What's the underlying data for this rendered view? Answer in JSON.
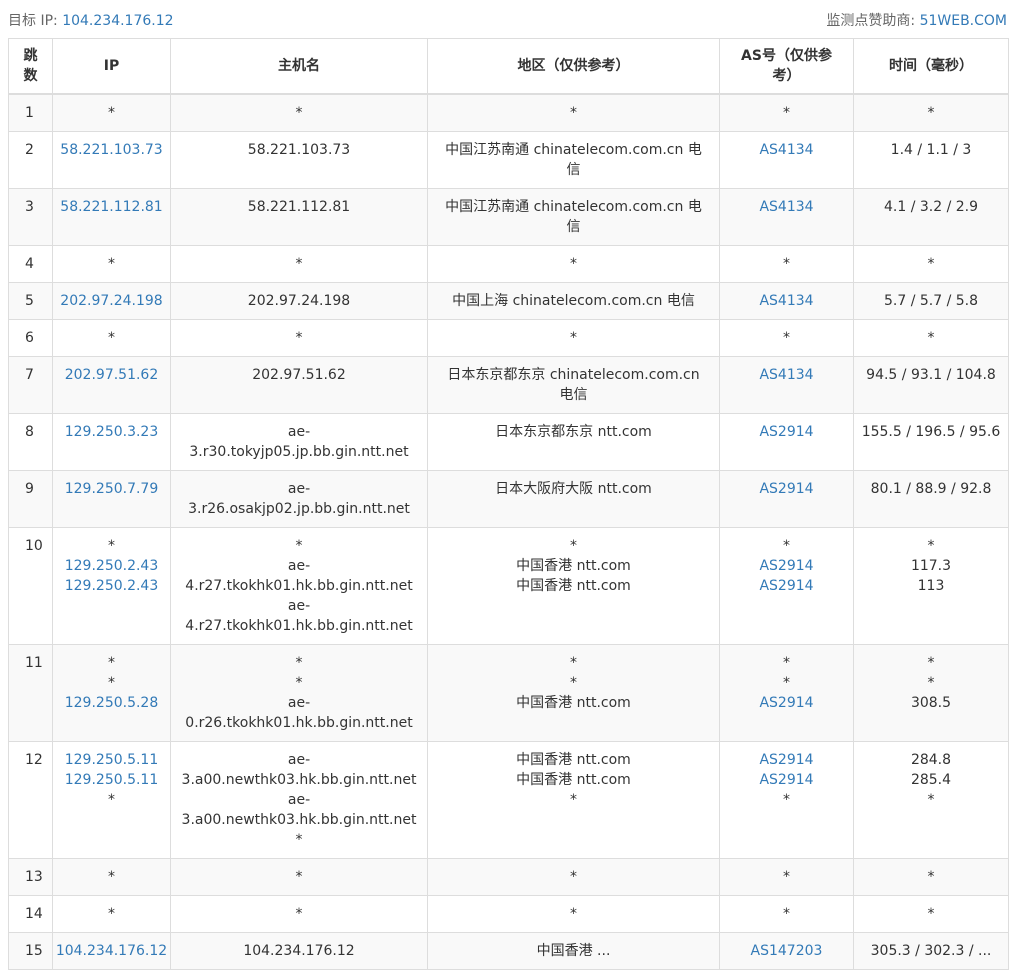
{
  "header": {
    "target_label": "目标 IP:",
    "target_ip": "104.234.176.12",
    "sponsor_label": "监测点赞助商:",
    "sponsor_name": "51WEB.COM"
  },
  "columns": {
    "hop": "跳数",
    "ip": "IP",
    "host": "主机名",
    "region": "地区（仅供参考）",
    "as": "AS号（仅供参考）",
    "time": "时间（毫秒）"
  },
  "rows": [
    {
      "hop": "1",
      "ip": [
        "*"
      ],
      "host": [
        "*"
      ],
      "region": [
        "*"
      ],
      "as": [
        "*"
      ],
      "time": [
        "*"
      ]
    },
    {
      "hop": "2",
      "ip": [
        "58.221.103.73"
      ],
      "host": [
        "58.221.103.73"
      ],
      "region": [
        "中国江苏南通 chinatelecom.com.cn 电信"
      ],
      "as": [
        "AS4134"
      ],
      "time": [
        "1.4 / 1.1 / 3"
      ]
    },
    {
      "hop": "3",
      "ip": [
        "58.221.112.81"
      ],
      "host": [
        "58.221.112.81"
      ],
      "region": [
        "中国江苏南通 chinatelecom.com.cn 电信"
      ],
      "as": [
        "AS4134"
      ],
      "time": [
        "4.1 / 3.2 / 2.9"
      ]
    },
    {
      "hop": "4",
      "ip": [
        "*"
      ],
      "host": [
        "*"
      ],
      "region": [
        "*"
      ],
      "as": [
        "*"
      ],
      "time": [
        "*"
      ]
    },
    {
      "hop": "5",
      "ip": [
        "202.97.24.198"
      ],
      "host": [
        "202.97.24.198"
      ],
      "region": [
        "中国上海 chinatelecom.com.cn 电信"
      ],
      "as": [
        "AS4134"
      ],
      "time": [
        "5.7 / 5.7 / 5.8"
      ]
    },
    {
      "hop": "6",
      "ip": [
        "*"
      ],
      "host": [
        "*"
      ],
      "region": [
        "*"
      ],
      "as": [
        "*"
      ],
      "time": [
        "*"
      ]
    },
    {
      "hop": "7",
      "ip": [
        "202.97.51.62"
      ],
      "host": [
        "202.97.51.62"
      ],
      "region": [
        "日本东京都东京 chinatelecom.com.cn 电信"
      ],
      "as": [
        "AS4134"
      ],
      "time": [
        "94.5 / 93.1 / 104.8"
      ]
    },
    {
      "hop": "8",
      "ip": [
        "129.250.3.23"
      ],
      "host": [
        "ae-3.r30.tokyjp05.jp.bb.gin.ntt.net"
      ],
      "region": [
        "日本东京都东京 ntt.com"
      ],
      "as": [
        "AS2914"
      ],
      "time": [
        "155.5 / 196.5 / 95.6"
      ]
    },
    {
      "hop": "9",
      "ip": [
        "129.250.7.79"
      ],
      "host": [
        "ae-3.r26.osakjp02.jp.bb.gin.ntt.net"
      ],
      "region": [
        "日本大阪府大阪 ntt.com"
      ],
      "as": [
        "AS2914"
      ],
      "time": [
        "80.1 / 88.9 / 92.8"
      ]
    },
    {
      "hop": "10",
      "ip": [
        "*",
        "129.250.2.43",
        "129.250.2.43"
      ],
      "host": [
        "*",
        "ae-4.r27.tkokhk01.hk.bb.gin.ntt.net",
        "ae-4.r27.tkokhk01.hk.bb.gin.ntt.net"
      ],
      "region": [
        "*",
        "中国香港 ntt.com",
        "中国香港 ntt.com"
      ],
      "as": [
        "*",
        "AS2914",
        "AS2914"
      ],
      "time": [
        "*",
        "117.3",
        "113"
      ]
    },
    {
      "hop": "11",
      "ip": [
        "*",
        "*",
        "129.250.5.28"
      ],
      "host": [
        "*",
        "*",
        "ae-0.r26.tkokhk01.hk.bb.gin.ntt.net"
      ],
      "region": [
        "*",
        "*",
        "中国香港 ntt.com"
      ],
      "as": [
        "*",
        "*",
        "AS2914"
      ],
      "time": [
        "*",
        "*",
        "308.5"
      ]
    },
    {
      "hop": "12",
      "ip": [
        "129.250.5.11",
        "129.250.5.11",
        "*"
      ],
      "host": [
        "ae-3.a00.newthk03.hk.bb.gin.ntt.net",
        "ae-3.a00.newthk03.hk.bb.gin.ntt.net",
        "*"
      ],
      "region": [
        "中国香港 ntt.com",
        "中国香港 ntt.com",
        "*"
      ],
      "as": [
        "AS2914",
        "AS2914",
        "*"
      ],
      "time": [
        "284.8",
        "285.4",
        "*"
      ]
    },
    {
      "hop": "13",
      "ip": [
        "*"
      ],
      "host": [
        "*"
      ],
      "region": [
        "*"
      ],
      "as": [
        "*"
      ],
      "time": [
        "*"
      ]
    },
    {
      "hop": "14",
      "ip": [
        "*"
      ],
      "host": [
        "*"
      ],
      "region": [
        "*"
      ],
      "as": [
        "*"
      ],
      "time": [
        "*"
      ]
    },
    {
      "hop": "15",
      "ip": [
        "104.234.176.12"
      ],
      "host": [
        "104.234.176.12"
      ],
      "region": [
        "中国香港 ..."
      ],
      "as": [
        "AS147203"
      ],
      "time": [
        "305.3 / 302.3 / ..."
      ]
    }
  ]
}
